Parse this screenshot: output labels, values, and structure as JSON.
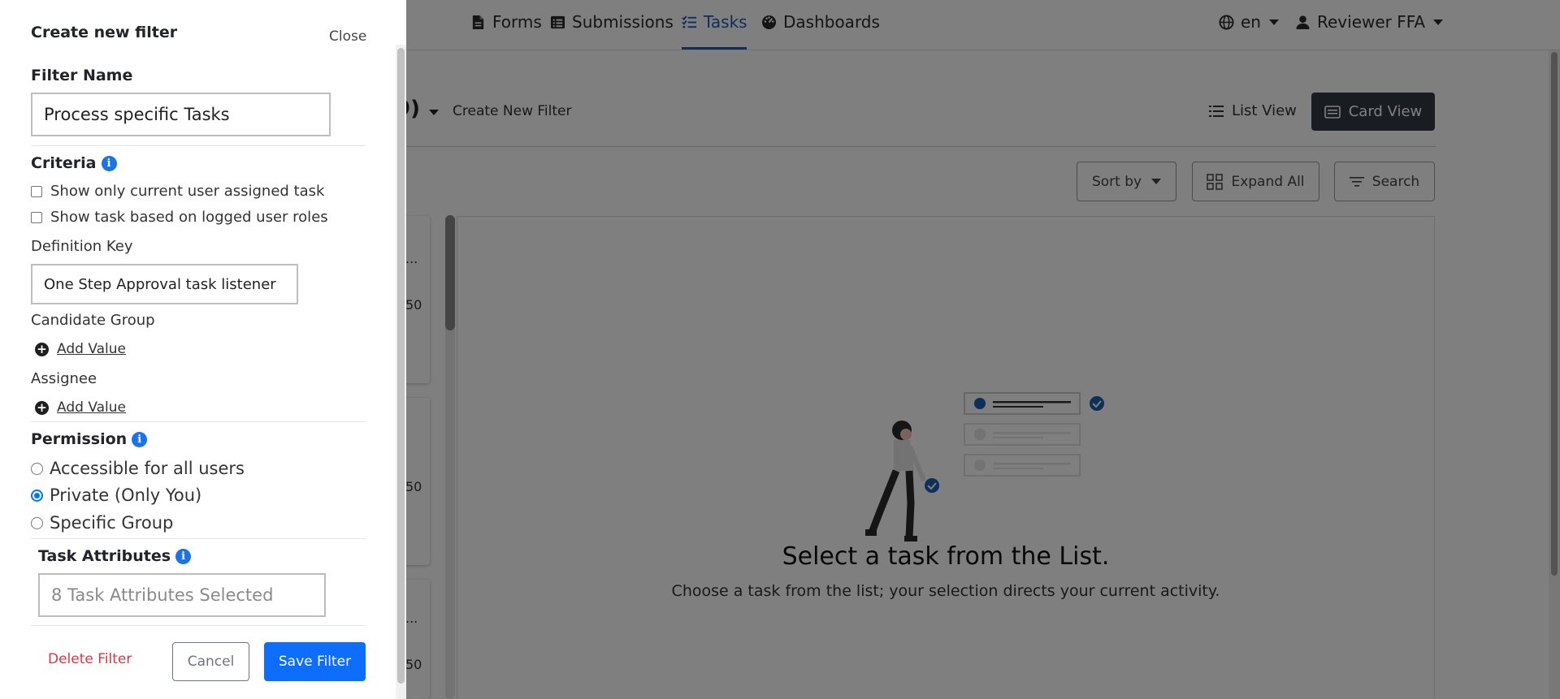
{
  "navbar": {
    "items": [
      {
        "label": "Forms",
        "icon": "file-icon"
      },
      {
        "label": "Submissions",
        "icon": "list-icon"
      },
      {
        "label": "Tasks",
        "icon": "tasks-icon",
        "active": true
      },
      {
        "label": "Dashboards",
        "icon": "dashboard-icon"
      }
    ],
    "language": "en",
    "user": "Reviewer FFA"
  },
  "task_page": {
    "filter_title_fragment": "9)",
    "create_new_filter": "Create New Filter",
    "list_view": "List View",
    "card_view": "Card View",
    "sort_by": "Sort by",
    "expand_all": "Expand All",
    "search": "Search",
    "list_card_fragments": [
      {
        "line1": "...",
        "line2": "50"
      },
      {
        "line1": "",
        "line2": "50"
      },
      {
        "line1": "...",
        "line2": "50"
      }
    ],
    "empty_title": "Select a task from the List.",
    "empty_subtitle": "Choose a task from the list; your selection directs your current activity."
  },
  "drawer": {
    "title": "Create new filter",
    "close": "Close",
    "filter_name_label": "Filter Name",
    "filter_name_value": "Process specific Tasks",
    "criteria_label": "Criteria",
    "checkboxes": [
      {
        "label": "Show only current user assigned task",
        "checked": false
      },
      {
        "label": "Show task based on logged user roles",
        "checked": false
      }
    ],
    "definition_key_label": "Definition Key",
    "definition_key_value": "One Step Approval task listener",
    "candidate_group_label": "Candidate Group",
    "assignee_label": "Assignee",
    "add_value": "Add Value",
    "permission_label": "Permission",
    "permission_options": [
      {
        "label": "Accessible for all users",
        "checked": false
      },
      {
        "label": "Private (Only You)",
        "checked": true
      },
      {
        "label": "Specific Group",
        "checked": false
      }
    ],
    "task_attributes_label": "Task Attributes",
    "task_attributes_placeholder": "8 Task Attributes Selected",
    "delete_filter": "Delete Filter",
    "cancel": "Cancel",
    "save_filter": "Save Filter"
  },
  "colors": {
    "primary": "#0d6efd",
    "danger": "#dc3545",
    "nav_active": "#1a5fb4",
    "card_view_bg": "#333b45",
    "info_icon": "#1a73e8"
  }
}
